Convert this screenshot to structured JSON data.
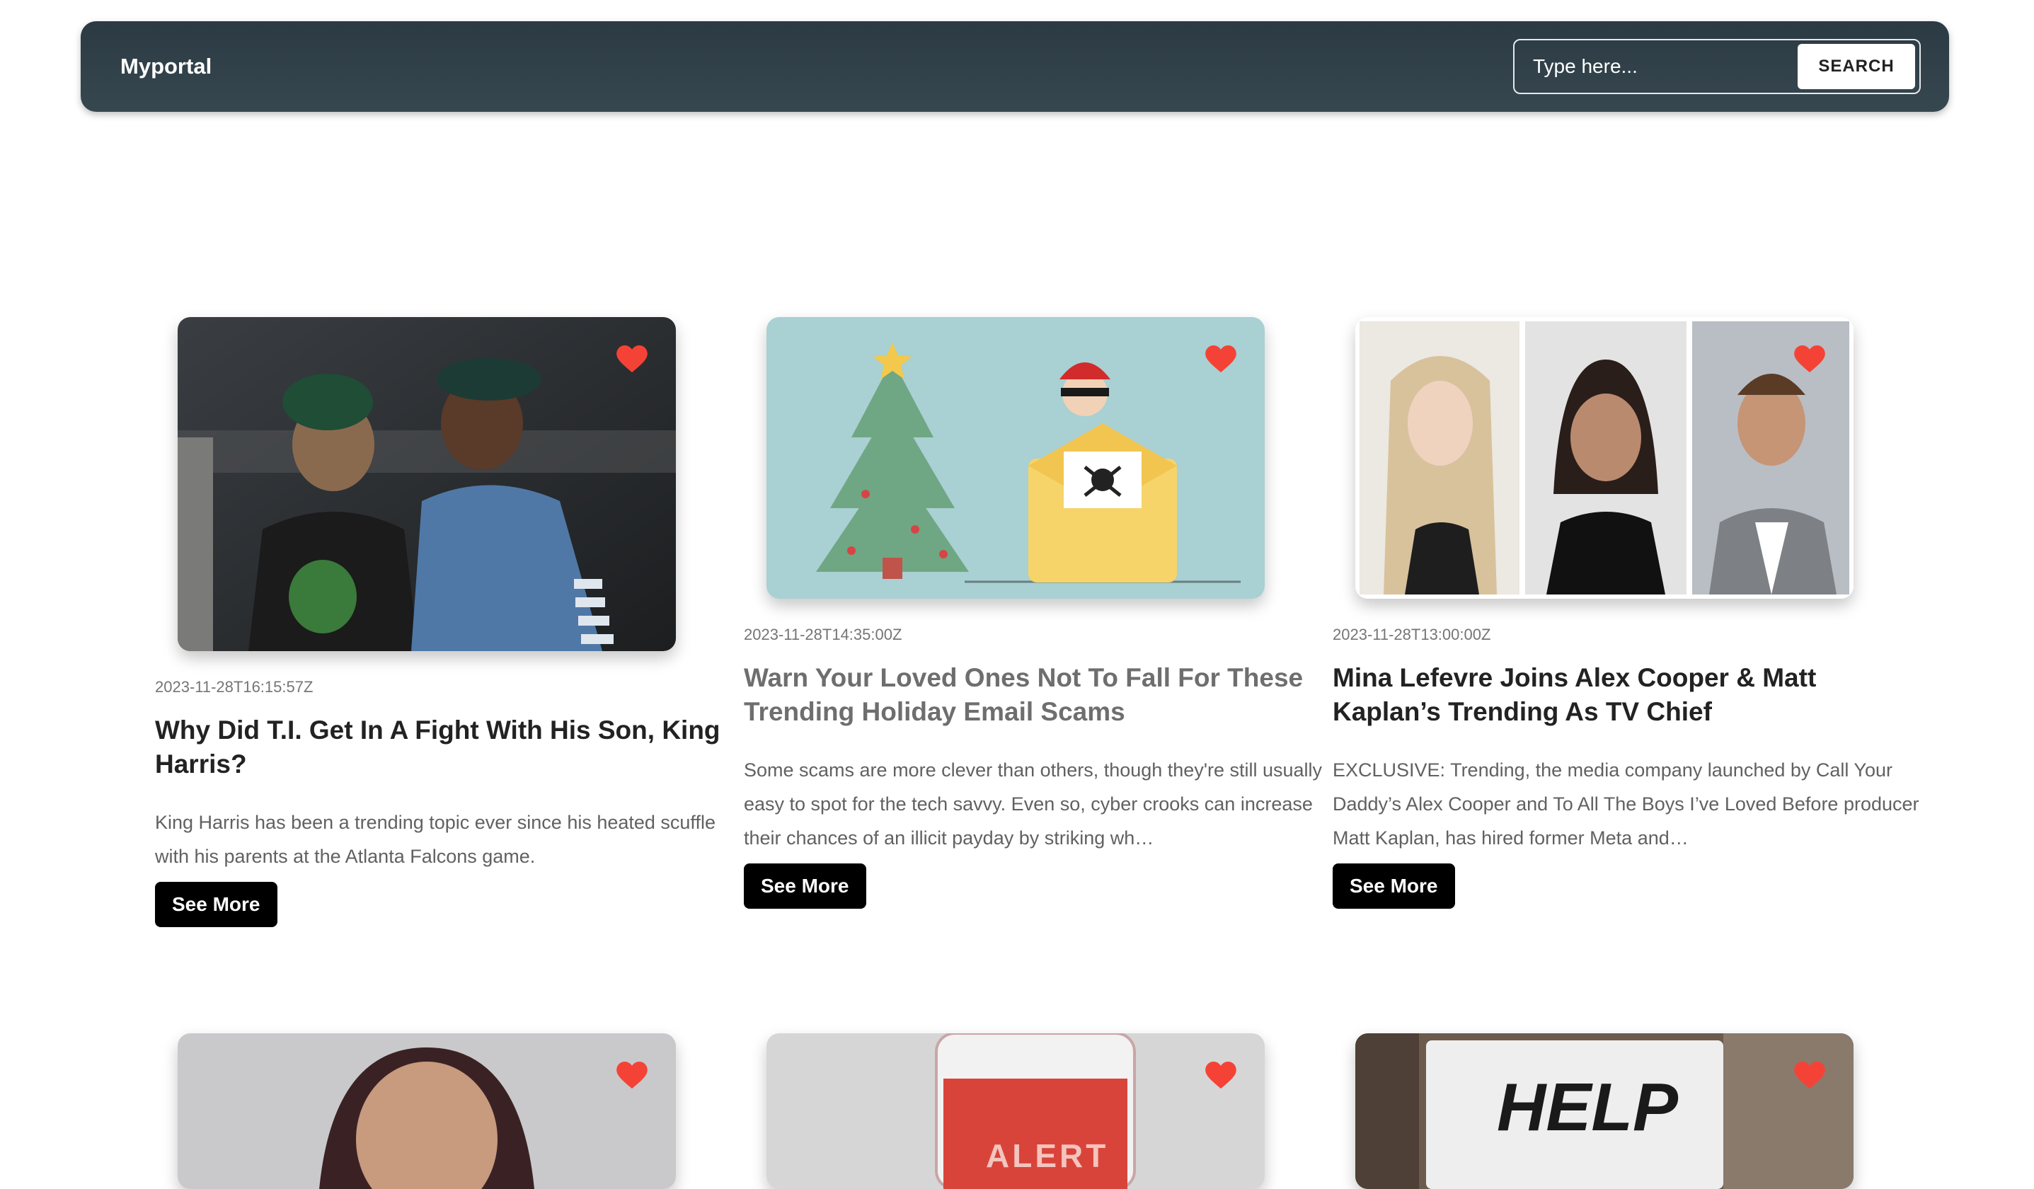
{
  "navbar": {
    "brand": "Myportal",
    "search": {
      "placeholder": "Type here...",
      "button_label": "SEARCH"
    }
  },
  "colors": {
    "navbar": "#2f3e46",
    "heart": "#f44336",
    "button": "#000000"
  },
  "articles": [
    {
      "date": "2023-11-28T16:15:57Z",
      "title": "Why Did T.I. Get In A Fight With His Son, King Harris?",
      "excerpt": "King Harris has been a trending topic ever since his heated scuffle with his parents at the Atlanta Falcons game.",
      "button_label": "See More"
    },
    {
      "date": "2023-11-28T14:35:00Z",
      "title": "Warn Your Loved Ones Not To Fall For These Trending Holiday Email Scams",
      "excerpt": "Some scams are more clever than others, though they're still usually easy to spot for the tech savvy. Even so, cyber crooks can increase their chances of an illicit payday by striking wh…",
      "button_label": "See More"
    },
    {
      "date": "2023-11-28T13:00:00Z",
      "title": "Mina Lefevre Joins Alex Cooper & Matt Kaplan’s Trending As TV Chief",
      "excerpt": "EXCLUSIVE: Trending, the media company launched by Call Your Daddy’s Alex Cooper and To All The Boys I’ve Loved Before producer Matt Kaplan, has hired former Meta and…",
      "button_label": "See More"
    }
  ],
  "bottom_row": {
    "alert_sign": "ALERT",
    "help_sign": "HELP"
  }
}
